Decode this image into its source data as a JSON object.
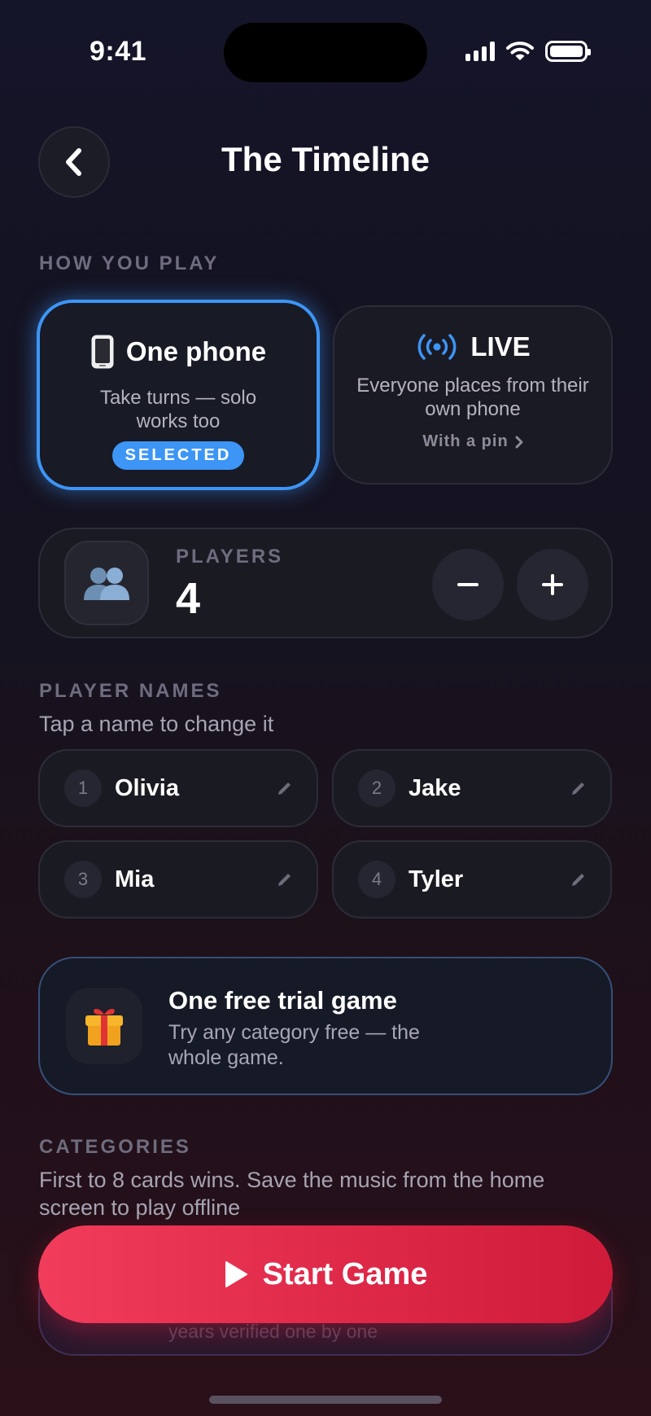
{
  "status_bar": {
    "time": "9:41"
  },
  "header": {
    "title": "The Timeline"
  },
  "how_you_play": {
    "label": "HOW YOU PLAY",
    "modes": [
      {
        "title": "One phone",
        "description": "Take turns — solo works too",
        "badge": "SELECTED",
        "selected": true,
        "icon": "phone-icon"
      },
      {
        "title": "LIVE",
        "description": "Everyone places from their own phone",
        "link": "With a pin",
        "selected": false,
        "icon": "broadcast-icon"
      }
    ]
  },
  "players": {
    "label": "PLAYERS",
    "count": "4",
    "icon": "people-icon"
  },
  "player_names": {
    "label": "PLAYER NAMES",
    "hint": "Tap a name to change it",
    "names": [
      {
        "num": "1",
        "name": "Olivia"
      },
      {
        "num": "2",
        "name": "Jake"
      },
      {
        "num": "3",
        "name": "Mia"
      },
      {
        "num": "4",
        "name": "Tyler"
      }
    ]
  },
  "trial": {
    "title": "One free trial game",
    "description": "Try any category free — the whole game.",
    "icon": "gift-icon"
  },
  "categories": {
    "label": "CATEGORIES",
    "description": "First to 8 cards wins. Save the music from the home screen to play offline",
    "peek_text": "years verified one by one"
  },
  "start_button": {
    "label": "Start Game"
  },
  "colors": {
    "accent_blue": "#3d95f5",
    "start_red": "#e02a4a"
  }
}
